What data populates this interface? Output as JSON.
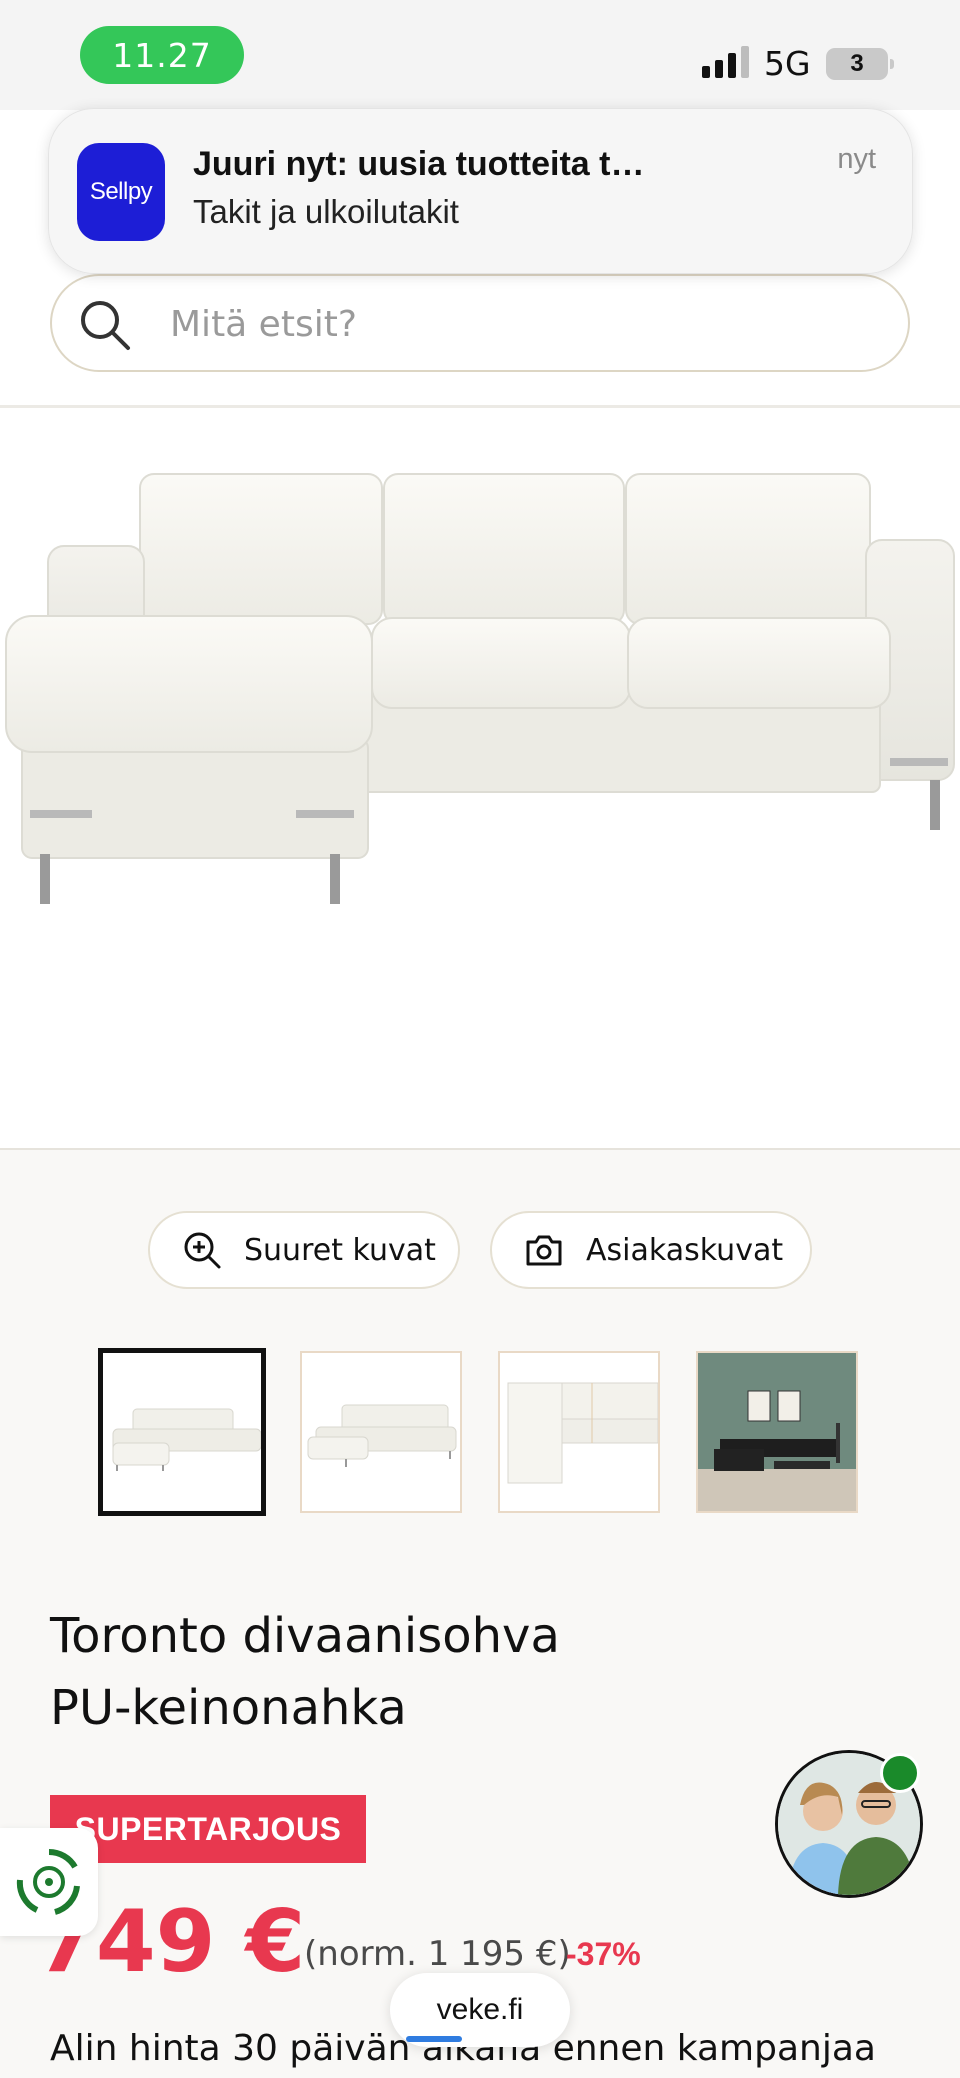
{
  "status_bar": {
    "time": "11.27",
    "network": "5G",
    "battery": "3"
  },
  "notification": {
    "app_name": "Sellpy",
    "title": "Juuri nyt: uusia tuotteita tallennetu...",
    "body": "Takit ja ulkoilutakit",
    "time": "nyt"
  },
  "search": {
    "placeholder": "Mitä etsit?"
  },
  "gallery": {
    "large_images_label": "Suuret kuvat",
    "customer_images_label": "Asiakaskuvat",
    "thumbnails": [
      "sofa-front",
      "sofa-angle",
      "sofa-top",
      "sofa-room"
    ]
  },
  "product": {
    "title_line1": "Toronto divaanisohva",
    "title_line2": "PU-keinonahka",
    "badge": "SUPERTARJOUS",
    "price": "749 €",
    "normal_price": "(norm. 1 195 €)",
    "discount": "-37%",
    "price_note": "Alin hinta 30 päivän aikana ennen kampanjaa"
  },
  "browser": {
    "url": "veke.fi",
    "load_progress": 0.3
  },
  "chat": {
    "online": true
  },
  "colors": {
    "accent": "#e8384f",
    "time_pill": "#34c759",
    "sellpy_blue": "#1d1ed6",
    "online": "#1a8a2a"
  }
}
